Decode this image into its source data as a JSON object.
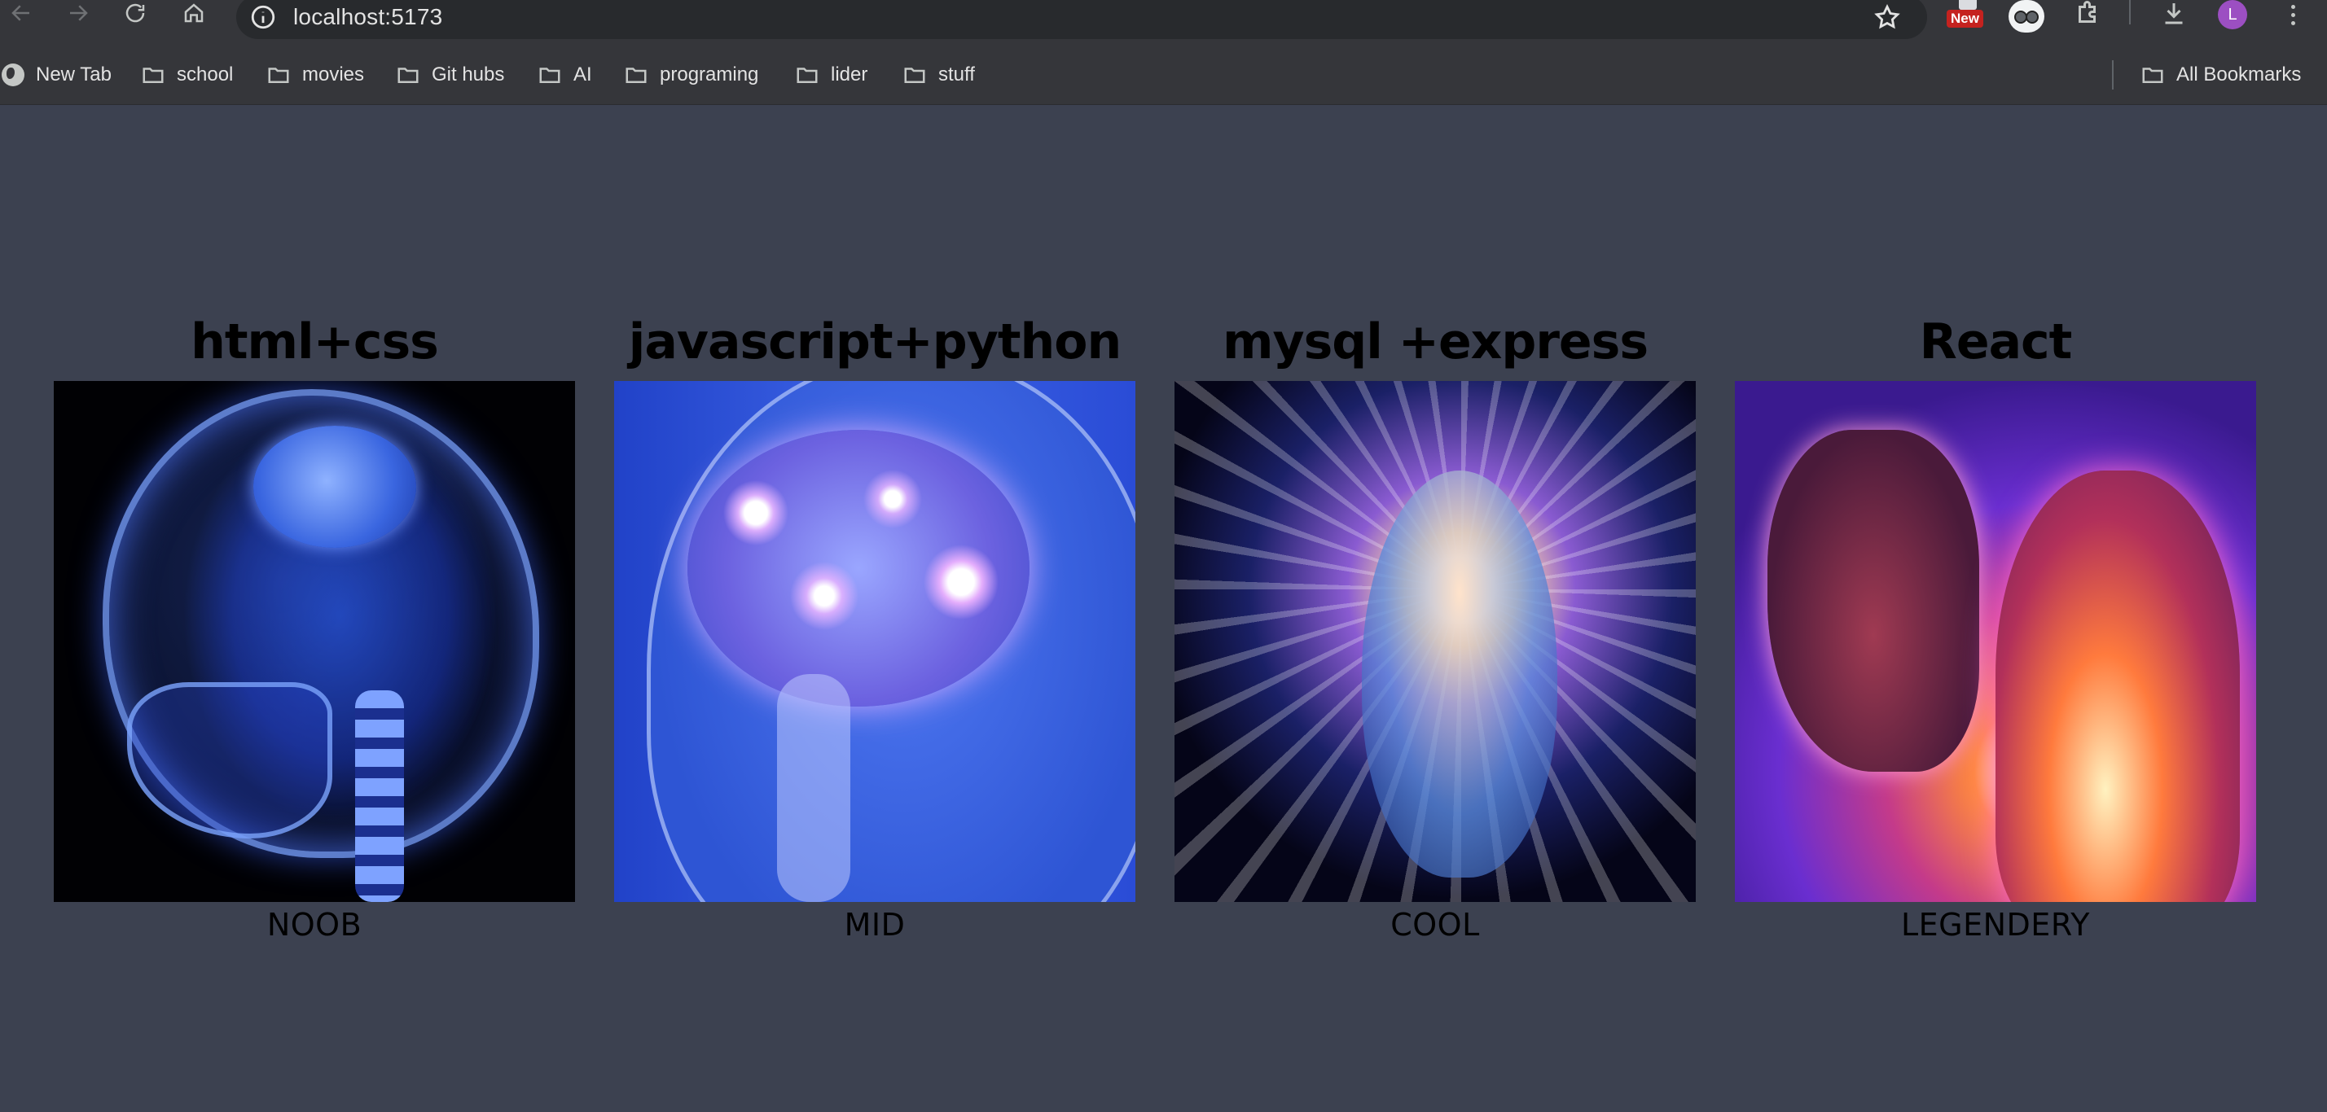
{
  "browser": {
    "url": "localhost:5173",
    "extension_badge": "New",
    "profile_initial": "L",
    "accent_color": "#9c4fc2"
  },
  "bookmarks": {
    "items": [
      {
        "label": "New Tab",
        "icon": "globe-icon"
      },
      {
        "label": "school",
        "icon": "folder-icon"
      },
      {
        "label": "movies",
        "icon": "folder-icon"
      },
      {
        "label": "Git hubs",
        "icon": "folder-icon"
      },
      {
        "label": "AI",
        "icon": "folder-icon"
      },
      {
        "label": "programing",
        "icon": "folder-icon"
      },
      {
        "label": "lider",
        "icon": "folder-icon"
      },
      {
        "label": "stuff",
        "icon": "folder-icon"
      }
    ],
    "all_bookmarks": "All Bookmarks"
  },
  "cards": [
    {
      "title": "html+css",
      "caption": "NOOB"
    },
    {
      "title": "javascript+python",
      "caption": "MID"
    },
    {
      "title": "mysql +express",
      "caption": "COOL"
    },
    {
      "title": "React",
      "caption": "LEGENDERY"
    }
  ],
  "colors": {
    "page_background": "#3c4150",
    "chrome_background": "#35363a"
  }
}
